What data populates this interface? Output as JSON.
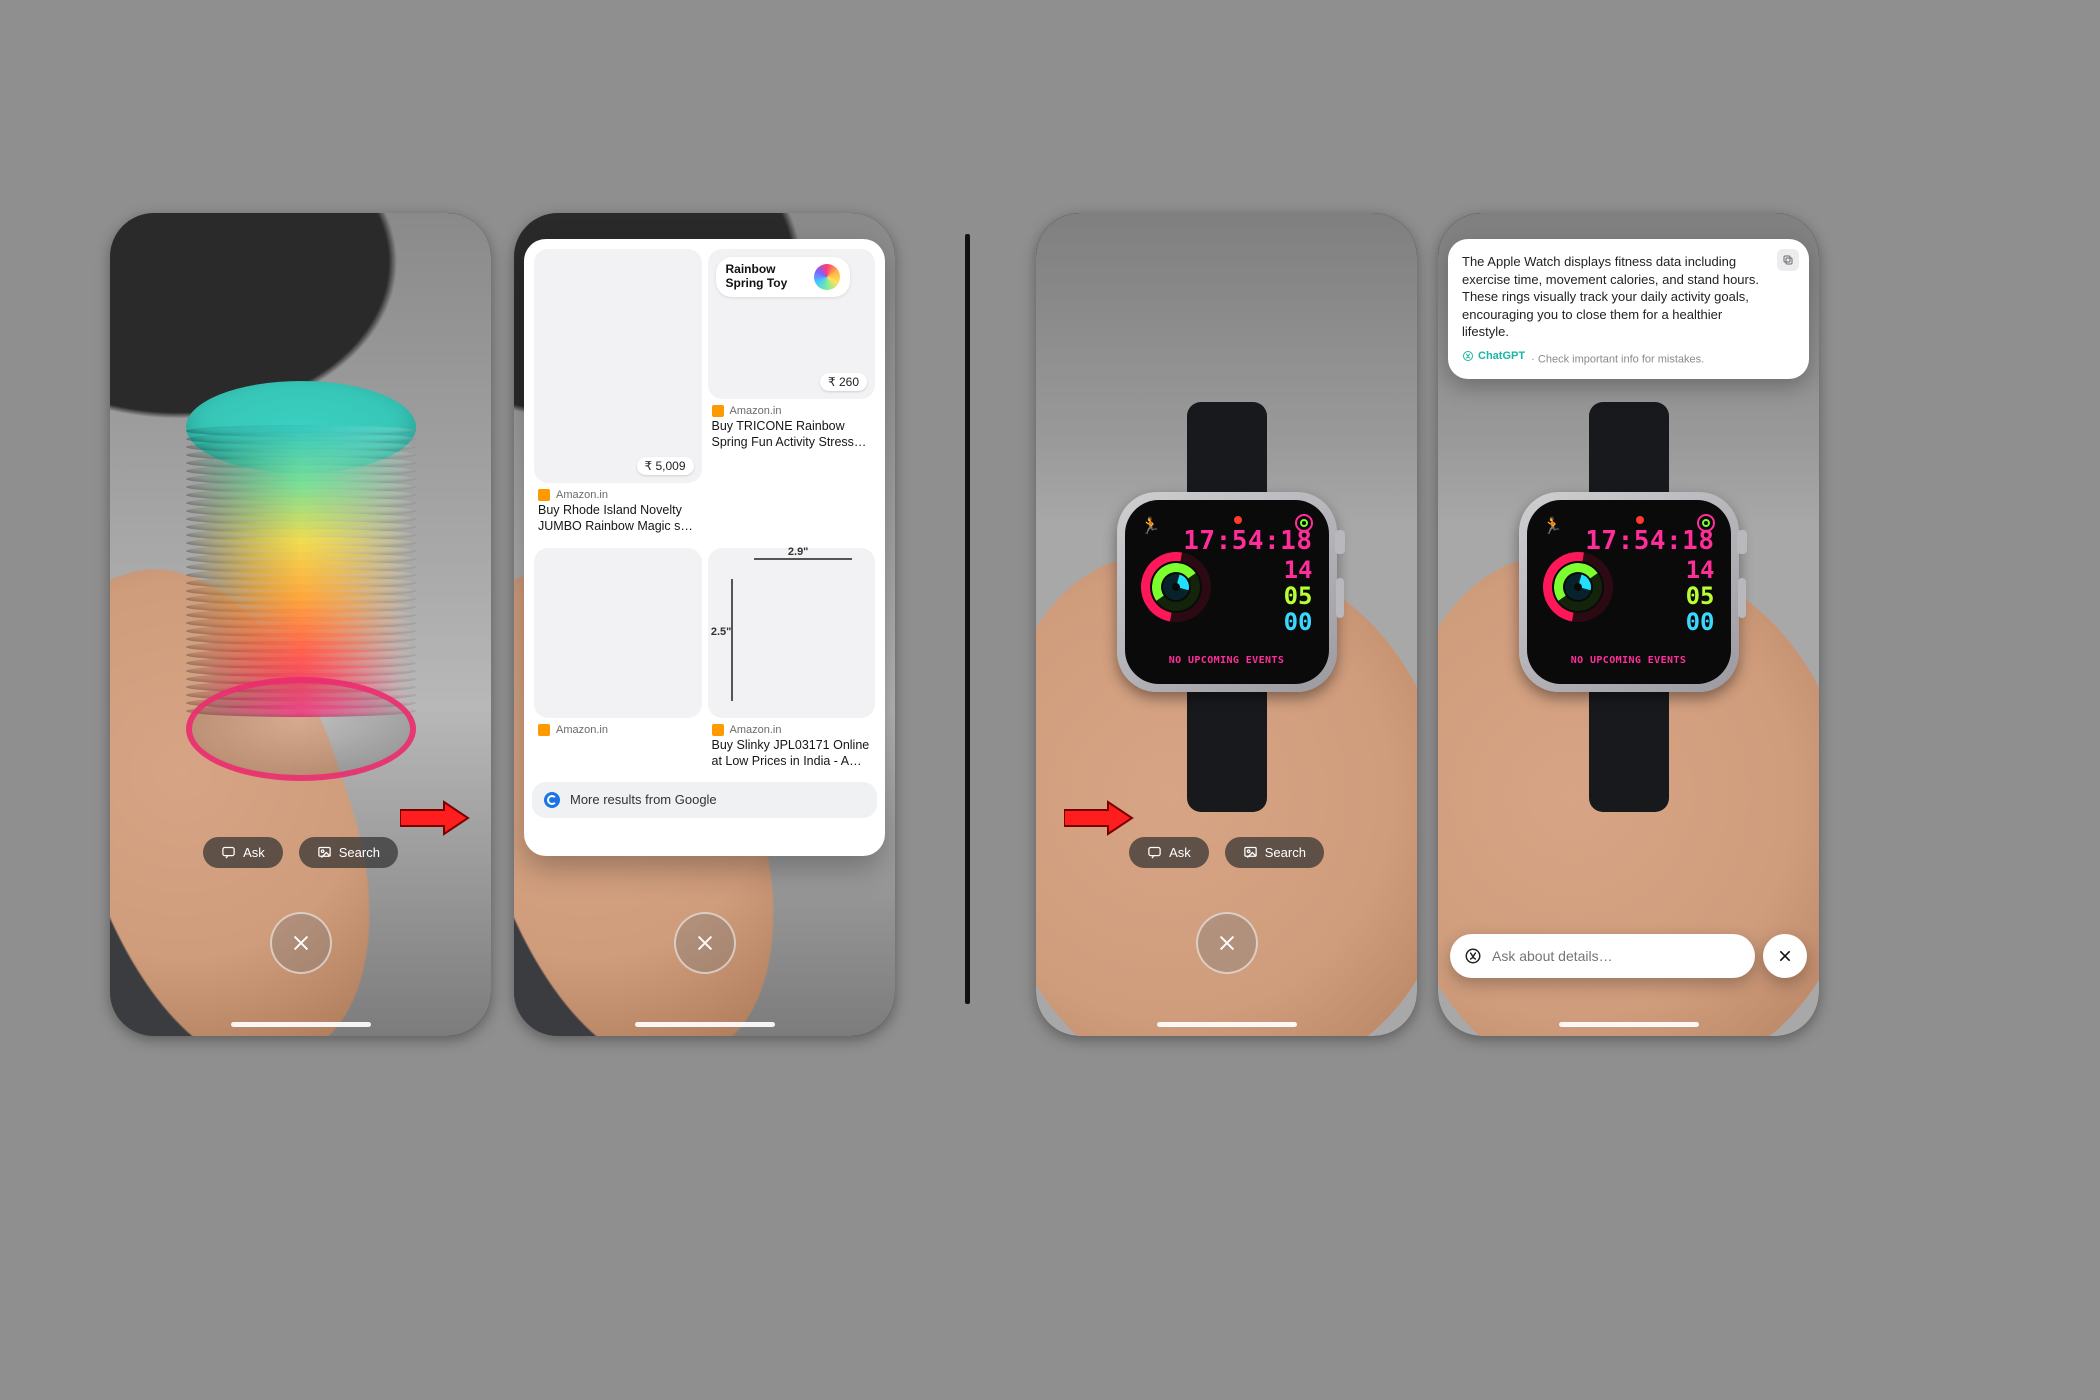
{
  "buttons": {
    "ask": "Ask",
    "search": "Search"
  },
  "search_sheet": {
    "keyword": "Rainbow Spring Toy",
    "items": [
      {
        "source": "Amazon.in",
        "title": "Buy Rhode Island Novelty JUMBO Rainbow Magic s…",
        "price": "₹ 5,009"
      },
      {
        "source": "Amazon.in",
        "title": "Buy TRICONE Rainbow Spring Fun Activity Stress…",
        "price": "₹ 260"
      },
      {
        "source": "Amazon.in",
        "title": "",
        "price": ""
      },
      {
        "source": "Amazon.in",
        "title": "Buy Slinky JPL03171 Online at Low Prices in India - A…",
        "price": ""
      }
    ],
    "dims": {
      "w": "2.9\"",
      "h": "2.5\""
    },
    "more": "More results from Google"
  },
  "watch": {
    "time": "17:54:18",
    "row1": "14",
    "row2": "05",
    "row3": "00",
    "events": "NO UPCOMING EVENTS"
  },
  "gpt": {
    "text": "The Apple Watch displays fitness data including exercise time, movement calories, and stand hours. These rings visually track your daily activity goals, encouraging you to close them for a healthier lifestyle.",
    "brand": "ChatGPT",
    "disclaimer": "Check important info for mistakes."
  },
  "ask_input": {
    "placeholder": "Ask about details…"
  }
}
